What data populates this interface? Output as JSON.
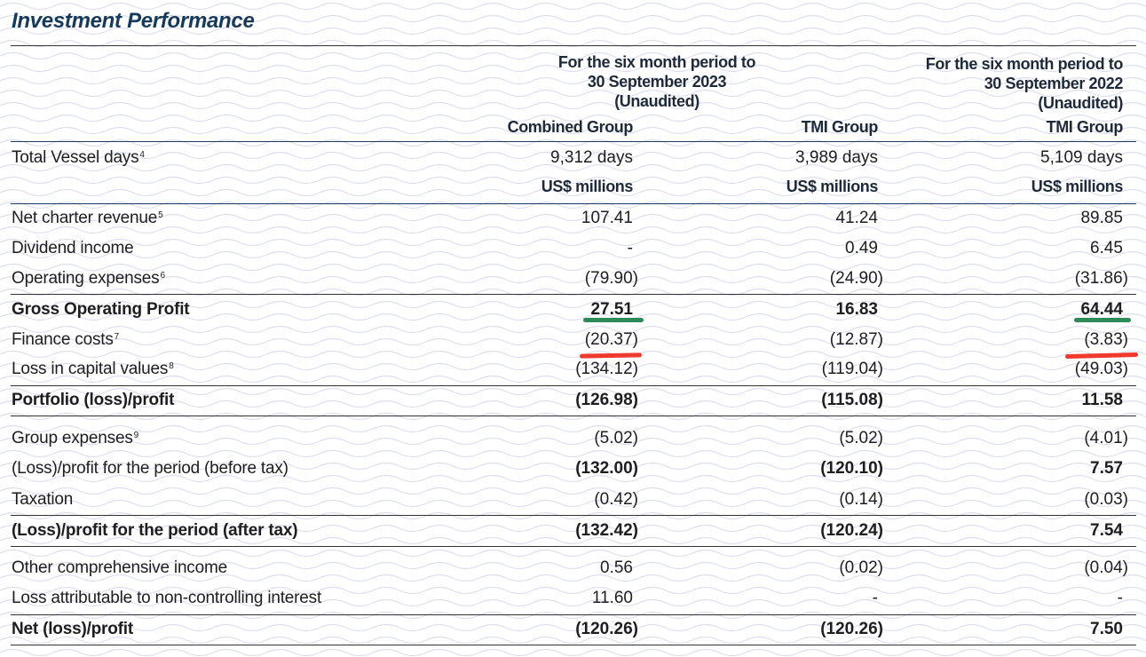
{
  "title": "Investment Performance",
  "headers": {
    "period_2023": [
      "For the six month period to",
      "30 September 2023",
      "(Unaudited)"
    ],
    "period_2022": [
      "For the six month period to",
      "30 September 2022",
      "(Unaudited)"
    ],
    "columns": [
      "Combined Group",
      "TMI Group",
      "TMI Group"
    ]
  },
  "rows": [
    {
      "label": "Total Vessel days",
      "note": "4",
      "values": [
        "9,312 days",
        "3,989 days",
        "5,109 days"
      ],
      "style": "normal"
    },
    {
      "label": "",
      "note": "",
      "values": [
        "US$ millions",
        "US$ millions",
        "US$ millions"
      ],
      "style": "unit"
    },
    {
      "label": "Net charter revenue",
      "note": "5",
      "values": [
        "107.41",
        "41.24",
        "89.85"
      ],
      "style": "normal"
    },
    {
      "label": "Dividend income",
      "note": "",
      "values": [
        "-",
        "0.49",
        "6.45"
      ],
      "style": "normal"
    },
    {
      "label": "Operating expenses",
      "note": "6",
      "values": [
        "(79.90)",
        "(24.90)",
        "(31.86)"
      ],
      "style": "normal"
    },
    {
      "label": "Gross Operating Profit",
      "note": "",
      "values": [
        "27.51",
        "16.83",
        "64.44"
      ],
      "style": "bold"
    },
    {
      "label": "Finance costs",
      "note": "7",
      "values": [
        "(20.37)",
        "(12.87)",
        "(3.83)"
      ],
      "style": "normal"
    },
    {
      "label": "Loss in capital values",
      "note": "8",
      "values": [
        "(134.12)",
        "(119.04)",
        "(49.03)"
      ],
      "style": "normal"
    },
    {
      "label": "Portfolio (loss)/profit",
      "note": "",
      "values": [
        "(126.98)",
        "(115.08)",
        "11.58"
      ],
      "style": "bold"
    },
    {
      "label": "Group expenses",
      "note": "9",
      "values": [
        "(5.02)",
        "(5.02)",
        "(4.01)"
      ],
      "style": "normal"
    },
    {
      "label": "(Loss)/profit for the period (before tax)",
      "note": "",
      "values": [
        "(132.00)",
        "(120.10)",
        "7.57"
      ],
      "style": "mixed"
    },
    {
      "label": "Taxation",
      "note": "",
      "values": [
        "(0.42)",
        "(0.14)",
        "(0.03)"
      ],
      "style": "normal"
    },
    {
      "label": "(Loss)/profit for the period (after tax)",
      "note": "",
      "values": [
        "(132.42)",
        "(120.24)",
        "7.54"
      ],
      "style": "bold"
    },
    {
      "label": "Other comprehensive income",
      "note": "",
      "values": [
        "0.56",
        "(0.02)",
        "(0.04)"
      ],
      "style": "normal"
    },
    {
      "label": "Loss attributable to non-controlling interest",
      "note": "",
      "values": [
        "11.60",
        "-",
        "-"
      ],
      "style": "normal"
    },
    {
      "label": "Net (loss)/profit",
      "note": "",
      "values": [
        "(120.26)",
        "(120.26)",
        "7.50"
      ],
      "style": "bold"
    }
  ],
  "annotations": {
    "green": "#2e8b57",
    "red": "#f03a2e"
  },
  "colors": {
    "title": "#183a5a",
    "pattern": "#d9dcf0"
  }
}
